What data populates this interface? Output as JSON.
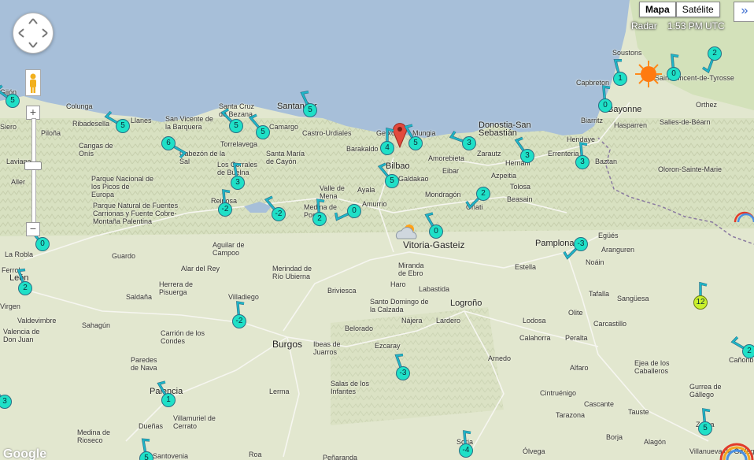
{
  "map_type": {
    "options": [
      "Mapa",
      "Satélite"
    ],
    "selected": "Mapa"
  },
  "expand_label": "»",
  "radar_label": "Radar",
  "time_label": "1:53 PM UTC",
  "google_label": "Google",
  "colors": {
    "sea": "#a7bfd9",
    "land": "#dfe6c8",
    "station": "#1fe0c7",
    "station_hot": "#c9f02c",
    "pin": "#e24a3e",
    "sun": "#ff7a10"
  },
  "places": [
    {
      "name": "Gijón",
      "cls": ""
    },
    {
      "name": "Colunga",
      "cls": ""
    },
    {
      "name": "Llanes",
      "cls": ""
    },
    {
      "name": "Ribadesella",
      "cls": ""
    },
    {
      "name": "San Vicente de la Barquera",
      "cls": ""
    },
    {
      "name": "Santa Cruz de Bezana",
      "cls": ""
    },
    {
      "name": "Santander",
      "cls": "med"
    },
    {
      "name": "Camargo",
      "cls": ""
    },
    {
      "name": "Castro-Urdiales",
      "cls": ""
    },
    {
      "name": "Barakaldo",
      "cls": ""
    },
    {
      "name": "Getxo",
      "cls": ""
    },
    {
      "name": "Mungia",
      "cls": ""
    },
    {
      "name": "Bilbao",
      "cls": "med"
    },
    {
      "name": "Amorebieta",
      "cls": ""
    },
    {
      "name": "Donostia-San Sebastián",
      "cls": "med"
    },
    {
      "name": "Zarautz",
      "cls": ""
    },
    {
      "name": "Hernani",
      "cls": ""
    },
    {
      "name": "Errenteria",
      "cls": ""
    },
    {
      "name": "Hendaye",
      "cls": ""
    },
    {
      "name": "Biarritz",
      "cls": ""
    },
    {
      "name": "Bayonne",
      "cls": "med"
    },
    {
      "name": "Capbreton",
      "cls": ""
    },
    {
      "name": "Soustons",
      "cls": ""
    },
    {
      "name": "Saint-Vincent-de-Tyrosse",
      "cls": ""
    },
    {
      "name": "Orthez",
      "cls": ""
    },
    {
      "name": "Hasparren",
      "cls": ""
    },
    {
      "name": "Salies-de-Béarn",
      "cls": ""
    },
    {
      "name": "Oloron-Sainte-Marie",
      "cls": ""
    },
    {
      "name": "Baztan",
      "cls": ""
    },
    {
      "name": "Siero",
      "cls": ""
    },
    {
      "name": "Piloña",
      "cls": ""
    },
    {
      "name": "Cangas de Onís",
      "cls": ""
    },
    {
      "name": "Cabezón de la Sal",
      "cls": ""
    },
    {
      "name": "Torrelavega",
      "cls": ""
    },
    {
      "name": "Los Corrales de Buelna",
      "cls": ""
    },
    {
      "name": "Santa María de Cayón",
      "cls": ""
    },
    {
      "name": "Laviana",
      "cls": ""
    },
    {
      "name": "Aller",
      "cls": ""
    },
    {
      "name": "Parque Nacional de los Picos de Europa",
      "cls": ""
    },
    {
      "name": "Parque Natural de Fuentes Carrionas y Fuente Cobre-Montaña Palentina",
      "cls": ""
    },
    {
      "name": "Reinosa",
      "cls": ""
    },
    {
      "name": "Valle de Mena",
      "cls": ""
    },
    {
      "name": "Medina de Pomar",
      "cls": ""
    },
    {
      "name": "Ayala",
      "cls": ""
    },
    {
      "name": "Amurrio",
      "cls": ""
    },
    {
      "name": "Galdakao",
      "cls": ""
    },
    {
      "name": "Eibar",
      "cls": ""
    },
    {
      "name": "Azpeitia",
      "cls": ""
    },
    {
      "name": "Tolosa",
      "cls": ""
    },
    {
      "name": "Mondragón",
      "cls": ""
    },
    {
      "name": "Beasain",
      "cls": ""
    },
    {
      "name": "Oñati",
      "cls": ""
    },
    {
      "name": "Vitoria-Gasteiz",
      "cls": "big"
    },
    {
      "name": "Pamplona",
      "cls": "med"
    },
    {
      "name": "Egüés",
      "cls": ""
    },
    {
      "name": "Aranguren",
      "cls": ""
    },
    {
      "name": "Noáin",
      "cls": ""
    },
    {
      "name": "Estella",
      "cls": ""
    },
    {
      "name": "Tafalla",
      "cls": ""
    },
    {
      "name": "Sangüesa",
      "cls": ""
    },
    {
      "name": "Olite",
      "cls": ""
    },
    {
      "name": "La Robla",
      "cls": ""
    },
    {
      "name": "Guardo",
      "cls": ""
    },
    {
      "name": "Aguilar de Campoo",
      "cls": ""
    },
    {
      "name": "Alar del Rey",
      "cls": ""
    },
    {
      "name": "Merindad de Río Ubierna",
      "cls": ""
    },
    {
      "name": "Briviesca",
      "cls": ""
    },
    {
      "name": "Miranda de Ebro",
      "cls": ""
    },
    {
      "name": "Haro",
      "cls": ""
    },
    {
      "name": "Labastida",
      "cls": ""
    },
    {
      "name": "Logroño",
      "cls": "med"
    },
    {
      "name": "Santo Domingo de la Calzada",
      "cls": ""
    },
    {
      "name": "Nájera",
      "cls": ""
    },
    {
      "name": "Lardero",
      "cls": ""
    },
    {
      "name": "Lodosa",
      "cls": ""
    },
    {
      "name": "Calahorra",
      "cls": ""
    },
    {
      "name": "Peralta",
      "cls": ""
    },
    {
      "name": "Carcastillo",
      "cls": ""
    },
    {
      "name": "Ferrol",
      "cls": ""
    },
    {
      "name": "León",
      "cls": "med"
    },
    {
      "name": "Virgen",
      "cls": ""
    },
    {
      "name": "Herrera de Pisuerga",
      "cls": ""
    },
    {
      "name": "Saldaña",
      "cls": ""
    },
    {
      "name": "Villadiego",
      "cls": ""
    },
    {
      "name": "Sahagún",
      "cls": ""
    },
    {
      "name": "Valdevimbre",
      "cls": ""
    },
    {
      "name": "Valencia de Don Juan",
      "cls": ""
    },
    {
      "name": "Carrión de los Condes",
      "cls": ""
    },
    {
      "name": "Burgos",
      "cls": "big"
    },
    {
      "name": "Ibeas de Juarros",
      "cls": ""
    },
    {
      "name": "Belorado",
      "cls": ""
    },
    {
      "name": "Ezcaray",
      "cls": ""
    },
    {
      "name": "Arnedo",
      "cls": ""
    },
    {
      "name": "Alfaro",
      "cls": ""
    },
    {
      "name": "Cintruénigo",
      "cls": ""
    },
    {
      "name": "Cascante",
      "cls": ""
    },
    {
      "name": "Tarazona",
      "cls": ""
    },
    {
      "name": "Tauste",
      "cls": ""
    },
    {
      "name": "Ejea de los Caballeros",
      "cls": ""
    },
    {
      "name": "Gurrea de Gállego",
      "cls": ""
    },
    {
      "name": "Paredes de Nava",
      "cls": ""
    },
    {
      "name": "Palencia",
      "cls": "med"
    },
    {
      "name": "Villamuriel de Cerrato",
      "cls": ""
    },
    {
      "name": "Lerma",
      "cls": ""
    },
    {
      "name": "Salas de los Infantes",
      "cls": ""
    },
    {
      "name": "Soria",
      "cls": ""
    },
    {
      "name": "Ólvega",
      "cls": ""
    },
    {
      "name": "Borja",
      "cls": ""
    },
    {
      "name": "Alagón",
      "cls": ""
    },
    {
      "name": "Zuera",
      "cls": ""
    },
    {
      "name": "Villanueva de Gállego",
      "cls": ""
    },
    {
      "name": "Cañonbre",
      "cls": ""
    },
    {
      "name": "Medina de Rioseco",
      "cls": ""
    },
    {
      "name": "Dueñas",
      "cls": ""
    },
    {
      "name": "Santovenia",
      "cls": ""
    },
    {
      "name": "Roa",
      "cls": ""
    },
    {
      "name": "Peñaranda",
      "cls": ""
    },
    {
      "name": "Valle de Mena",
      "cls": ""
    }
  ],
  "stations": [
    {
      "value": "5",
      "dir": 305,
      "hot": false
    },
    {
      "value": "5",
      "dir": 300,
      "hot": false
    },
    {
      "value": "6",
      "dir": 120,
      "hot": false
    },
    {
      "value": "5",
      "dir": 315,
      "hot": false
    },
    {
      "value": "5",
      "dir": 320,
      "hot": false
    },
    {
      "value": "5",
      "dir": 335,
      "hot": false
    },
    {
      "value": "3",
      "dir": 350,
      "hot": false
    },
    {
      "value": "-2",
      "dir": 355,
      "hot": false
    },
    {
      "value": "-2",
      "dir": 320,
      "hot": false
    },
    {
      "value": "2",
      "dir": 355,
      "hot": false
    },
    {
      "value": "0",
      "dir": 245,
      "hot": false
    },
    {
      "value": "5",
      "dir": 320,
      "hot": false
    },
    {
      "value": "4",
      "dir": 0,
      "hot": false
    },
    {
      "value": "5",
      "dir": 330,
      "hot": false
    },
    {
      "value": "3",
      "dir": 290,
      "hot": false
    },
    {
      "value": "2",
      "dir": 225,
      "hot": false
    },
    {
      "value": "3",
      "dir": 325,
      "hot": false
    },
    {
      "value": "3",
      "dir": 355,
      "hot": false
    },
    {
      "value": "0",
      "dir": 355,
      "hot": false
    },
    {
      "value": "0",
      "dir": 355,
      "hot": false
    },
    {
      "value": "1",
      "dir": 345,
      "hot": false
    },
    {
      "value": "0",
      "dir": 330,
      "hot": false
    },
    {
      "value": "2",
      "dir": 200,
      "hot": false
    },
    {
      "value": "0",
      "dir": 320,
      "hot": false
    },
    {
      "value": "-3",
      "dir": 225,
      "hot": false
    },
    {
      "value": "2",
      "dir": 340,
      "hot": false
    },
    {
      "value": "-2",
      "dir": 355,
      "hot": false
    },
    {
      "value": "12",
      "dir": 0,
      "hot": true
    },
    {
      "value": "-3",
      "dir": 340,
      "hot": false
    },
    {
      "value": "3",
      "dir": 320,
      "hot": false
    },
    {
      "value": "1",
      "dir": 330,
      "hot": false
    },
    {
      "value": "-4",
      "dir": 355,
      "hot": false
    },
    {
      "value": "5",
      "dir": 355,
      "hot": false
    },
    {
      "value": "2",
      "dir": 300,
      "hot": false
    },
    {
      "value": "5",
      "dir": 350,
      "hot": false
    }
  ]
}
